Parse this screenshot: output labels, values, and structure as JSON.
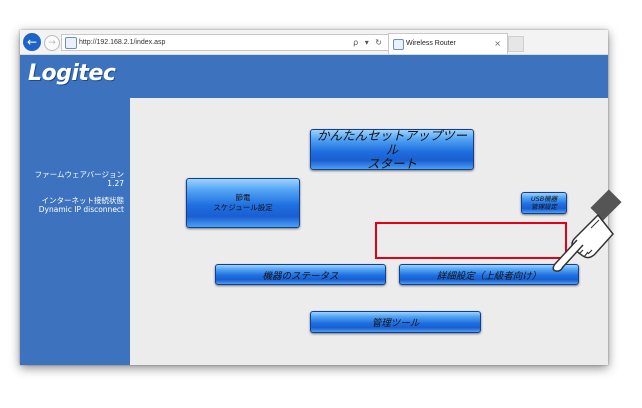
{
  "browser": {
    "url": "http://192.168.2.1/index.asp",
    "tab_title": "Wireless Router",
    "address_icons": "ρ ▾ ↻",
    "tab_close": "×"
  },
  "header": {
    "logo": "Logitec"
  },
  "sidebar": {
    "firmware_label": "ファームウェアバージョン",
    "firmware_version": "1.27",
    "connection_label": "インターネット接続状態",
    "connection_status": "Dynamic IP disconnect"
  },
  "buttons": {
    "easy_setup_line1": "かんたんセットアップツール",
    "easy_setup_line2": "スタート",
    "power_saving_line1": "節電",
    "power_saving_line2": "スケジュール設定",
    "usb_line1": "USB機器",
    "usb_line2": "管理設定",
    "status": "機器のステータス",
    "advanced": "詳細設定（上級者向け）",
    "admin": "管理ツール"
  },
  "colors": {
    "header_blue": "#3d73be",
    "content_bg": "#ececec",
    "highlight_red": "#e60012"
  },
  "icons": [
    "back-arrow-icon",
    "forward-arrow-icon",
    "page-icon",
    "search-icon",
    "refresh-icon",
    "close-icon",
    "pointing-hand-icon"
  ]
}
